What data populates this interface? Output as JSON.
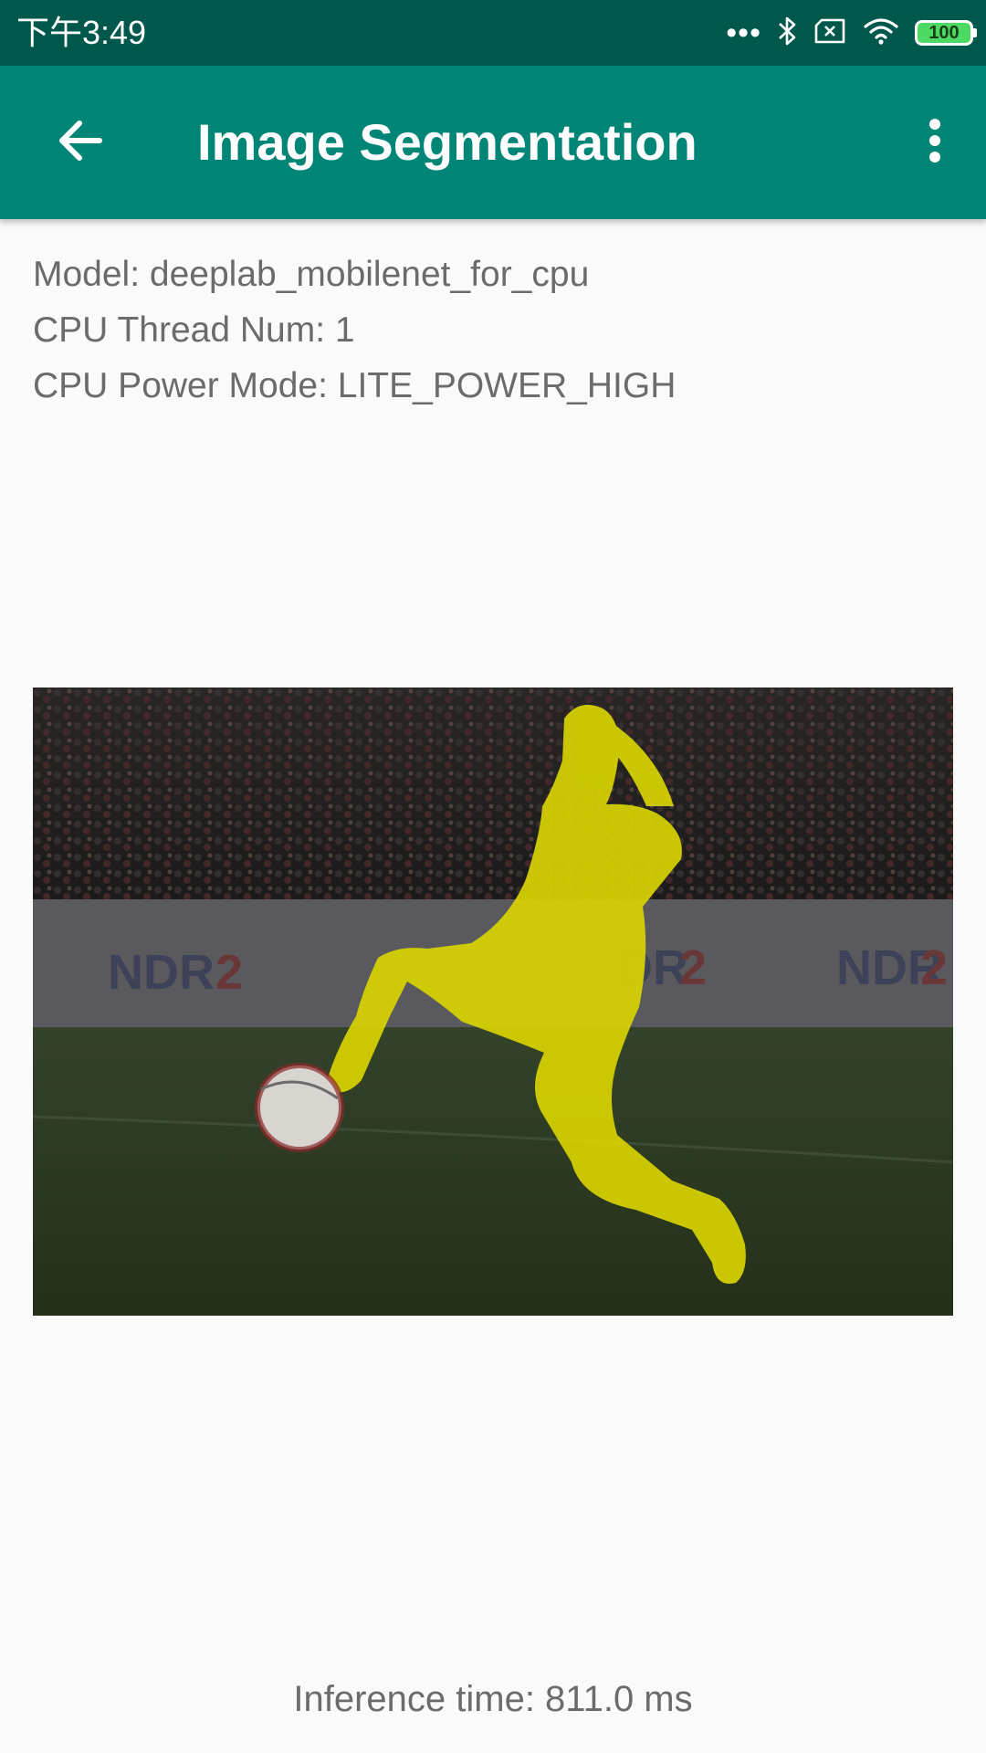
{
  "status_bar": {
    "time": "下午3:49",
    "dots": "•••",
    "battery": "100",
    "icons": [
      "bluetooth-icon",
      "sim-error-icon",
      "wifi-icon",
      "battery-icon"
    ]
  },
  "app_bar": {
    "title": "Image Segmentation",
    "back_icon": "arrow-back-icon",
    "menu_icon": "more-vert-icon",
    "background": "#008577"
  },
  "info": {
    "model": "Model: deeplab_mobilenet_for_cpu",
    "threads": "CPU Thread Num: 1",
    "power_mode": "CPU Power Mode: LITE_POWER_HIGH"
  },
  "result": {
    "mask_color": "#e0e000"
  },
  "footer": {
    "inference_time": "Inference time: 811.0 ms"
  }
}
